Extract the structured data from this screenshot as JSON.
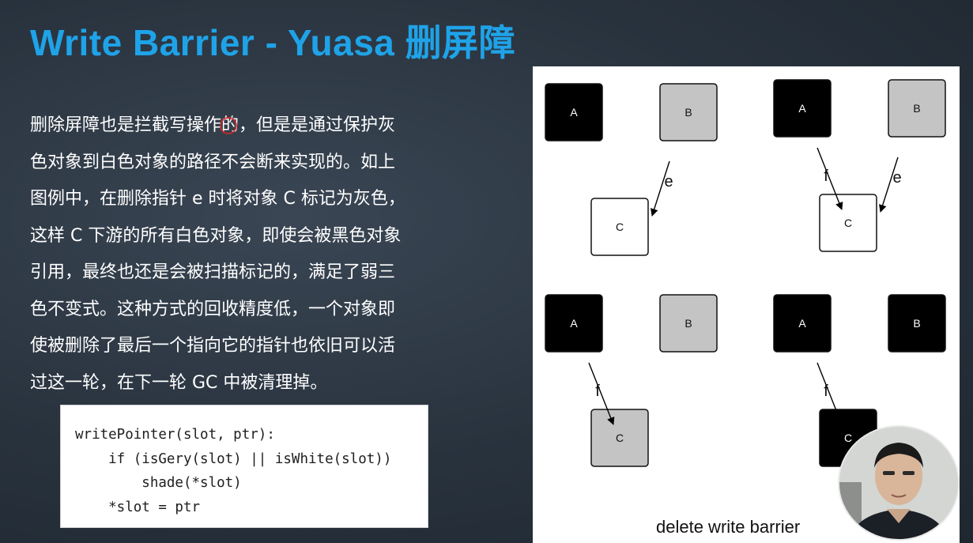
{
  "slide": {
    "title": "Write Barrier - Yuasa 删屏障",
    "description_lines": [
      "删除屏障也是拦截写操作的，但是是通过保护灰",
      "色对象到白色对象的路径不会断来实现的。如上",
      "图例中，在删除指针 e 时将对象 C 标记为灰色，",
      "这样 C 下游的所有白色对象，即使会被黑色对象",
      "引用，最终也还是会被扫描标记的，满足了弱三",
      "色不变式。这种方式的回收精度低，一个对象即",
      "使被删除了最后一个指向它的指针也依旧可以活",
      "过这一轮，在下一轮 GC 中被清理掉。"
    ],
    "code_lines": [
      "writePointer(slot, ptr):",
      "    if (isGery(slot) || isWhite(slot))",
      "        shade(*slot)",
      "    *slot = ptr"
    ]
  },
  "diagram": {
    "caption": "delete write barrier",
    "colors": {
      "black": "#000000",
      "grey": "#c4c4c4",
      "white": "#ffffff"
    },
    "panels": [
      {
        "nodes": [
          {
            "label": "A",
            "fill": "black"
          },
          {
            "label": "B",
            "fill": "grey"
          },
          {
            "label": "C",
            "fill": "white"
          }
        ],
        "edges": [
          {
            "from": "B",
            "to": "C",
            "label": "e"
          }
        ]
      },
      {
        "nodes": [
          {
            "label": "A",
            "fill": "black"
          },
          {
            "label": "B",
            "fill": "grey"
          },
          {
            "label": "C",
            "fill": "white"
          }
        ],
        "edges": [
          {
            "from": "A",
            "to": "C",
            "label": "f"
          },
          {
            "from": "B",
            "to": "C",
            "label": "e"
          }
        ]
      },
      {
        "nodes": [
          {
            "label": "A",
            "fill": "black"
          },
          {
            "label": "B",
            "fill": "grey"
          },
          {
            "label": "C",
            "fill": "grey"
          }
        ],
        "edges": [
          {
            "from": "A",
            "to": "C",
            "label": "f"
          }
        ]
      },
      {
        "nodes": [
          {
            "label": "A",
            "fill": "black"
          },
          {
            "label": "B",
            "fill": "black"
          },
          {
            "label": "C",
            "fill": "black"
          }
        ],
        "edges": [
          {
            "from": "A",
            "to": "C",
            "label": "f"
          }
        ]
      }
    ]
  }
}
